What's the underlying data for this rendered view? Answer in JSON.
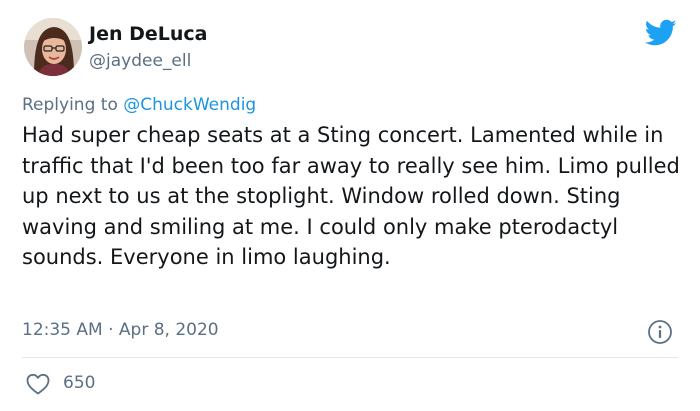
{
  "author": {
    "display_name": "Jen DeLuca",
    "handle": "@jaydee_ell",
    "avatar": "avatar-photo"
  },
  "reply": {
    "prefix": "Replying to ",
    "mention": "@ChuckWendig"
  },
  "tweet": {
    "text": "Had super cheap seats at a Sting concert. Lamented while in traffic that I'd been too far away to really see him. Limo pulled up next to us at the stoplight. Window rolled down. Sting waving and smiling at me. I could only make pterodactyl sounds. Everyone in limo laughing.",
    "timestamp": "12:35 AM · Apr 8, 2020",
    "likes": "650"
  },
  "icons": {
    "logo": "twitter-bird-icon",
    "info": "info-icon",
    "like": "heart-icon"
  },
  "colors": {
    "brand": "#1da1f2",
    "mention": "#1b95e0",
    "secondary_text": "#5b7083",
    "divider": "#e1e8ed"
  }
}
